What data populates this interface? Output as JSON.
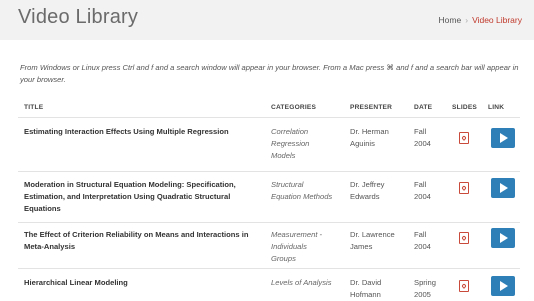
{
  "header": {
    "title": "Video Library",
    "breadcrumb": {
      "home": "Home",
      "separator": "›",
      "current": "Video Library"
    }
  },
  "intro": "From Windows or Linux press Ctrl and f and a search window will appear in your browser. From a Mac press ⌘ and f and a search bar will appear in your browser.",
  "table": {
    "columns": {
      "title": "TITLE",
      "categories": "CATEGORIES",
      "presenter": "PRESENTER",
      "date": "DATE",
      "slides": "SLIDES",
      "link": "LINK"
    },
    "rows": [
      {
        "title": "Estimating Interaction Effects Using Multiple Regression",
        "category": "Correlation Regression Models",
        "presenter": "Dr. Herman Aguinis",
        "date": "Fall 2004",
        "slides_icon": "pdf-icon",
        "link_icon": "play-icon"
      },
      {
        "title": "Moderation in Structural Equation Modeling: Specification, Estimation, and Interpretation Using Quadratic Structural Equations",
        "category": "Structural Equation Methods",
        "presenter": "Dr. Jeffrey Edwards",
        "date": "Fall 2004",
        "slides_icon": "pdf-icon",
        "link_icon": "play-icon"
      },
      {
        "title": "The Effect of Criterion Reliability on Means and Interactions in Meta-Analysis",
        "category": "Measurement - Individuals Groups",
        "presenter": "Dr. Lawrence James",
        "date": "Fall 2004",
        "slides_icon": "pdf-icon",
        "link_icon": "play-icon"
      },
      {
        "title": "Hierarchical Linear Modeling",
        "category": "Levels of Analysis",
        "presenter": "Dr. David Hofmann",
        "date": "Spring 2005",
        "slides_icon": "pdf-icon",
        "link_icon": "play-icon"
      }
    ]
  },
  "colors": {
    "accent": "#2e7fb8",
    "pdf": "#c94a3a",
    "breadcrumb_current": "#c0392b",
    "header_bg": "#f2f2f2"
  }
}
